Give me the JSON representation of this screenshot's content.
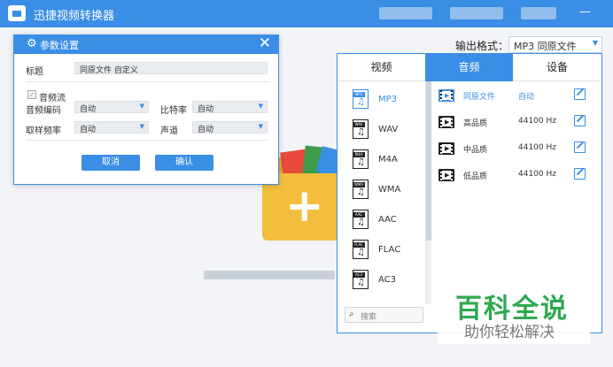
{
  "app": {
    "title": "迅捷视频转换器"
  },
  "window": {
    "minimize": "—"
  },
  "output": {
    "label": "输出格式：",
    "value": "MP3  同原文件"
  },
  "dialog": {
    "title": "参数设置",
    "title_field": {
      "label": "标题",
      "value": "同原文件 自定义"
    },
    "audio_stream": "音频流",
    "audio_codec": {
      "label": "音频编码",
      "value": "自动"
    },
    "bitrate": {
      "label": "比特率",
      "value": "自动"
    },
    "sample_rate": {
      "label": "取样频率",
      "value": "自动"
    },
    "channel": {
      "label": "声道",
      "value": "自动"
    },
    "cancel": "取消",
    "confirm": "确认"
  },
  "panel": {
    "tabs": [
      {
        "label": "视频"
      },
      {
        "label": "音频",
        "active": true
      },
      {
        "label": "设备"
      }
    ],
    "formats": [
      {
        "name": "MP3",
        "tag": "MP3",
        "selected": true
      },
      {
        "name": "WAV",
        "tag": "WAV"
      },
      {
        "name": "M4A",
        "tag": "M4A"
      },
      {
        "name": "WMA",
        "tag": "WMA"
      },
      {
        "name": "AAC",
        "tag": "AAC"
      },
      {
        "name": "FLAC",
        "tag": "FLAC"
      },
      {
        "name": "AC3",
        "tag": "AC3"
      }
    ],
    "search_placeholder": "搜索",
    "qualities": [
      {
        "name": "同原文件",
        "rate": "自动",
        "selected": true
      },
      {
        "name": "高品质",
        "rate": "44100 Hz"
      },
      {
        "name": "中品质",
        "rate": "44100 Hz"
      },
      {
        "name": "低品质",
        "rate": "44100 Hz"
      }
    ]
  },
  "watermark": {
    "title": "百科全说",
    "subtitle": "助你轻松解决"
  },
  "colors": {
    "accent": "#3a8ee6",
    "watermark_green": "#2fa84f"
  }
}
